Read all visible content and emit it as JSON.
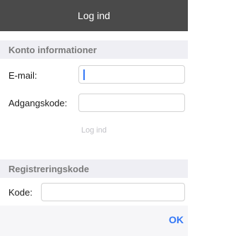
{
  "navbar": {
    "title": "Log ind"
  },
  "account_section": {
    "header": "Konto informationer"
  },
  "email": {
    "label": "E-mail:",
    "value": ""
  },
  "password": {
    "label": "Adgangskode:",
    "value": ""
  },
  "login_button": {
    "label": "Log ind"
  },
  "registration_section": {
    "header": "Registreringskode"
  },
  "code": {
    "label": "Kode:",
    "value": ""
  },
  "toolbar": {
    "ok_label": "OK"
  },
  "colors": {
    "navbar_bg": "#4a4a4a",
    "section_bg": "#efeff4",
    "accent": "#3478f6",
    "disabled_text": "#c2c2c7"
  }
}
